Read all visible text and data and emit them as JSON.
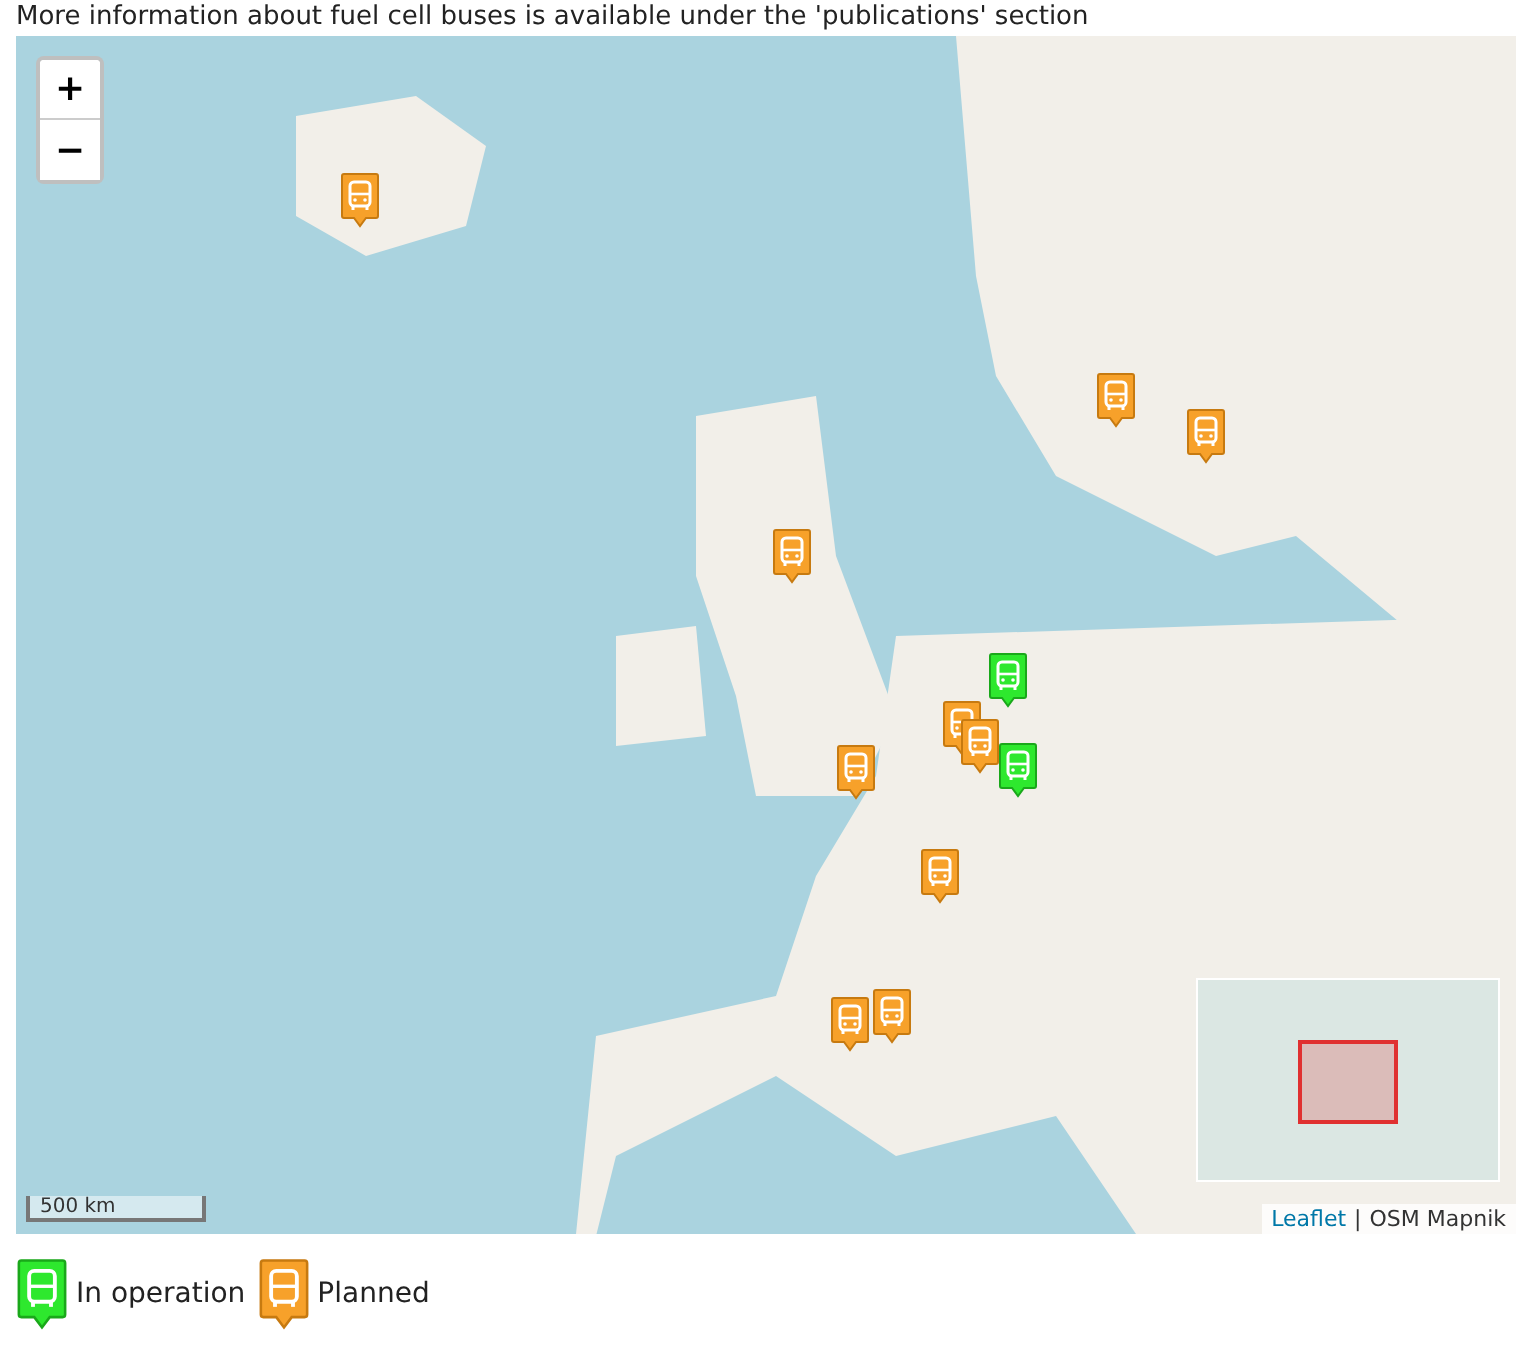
{
  "intro": "More information about fuel cell buses is available under the 'publications' section",
  "map": {
    "zoom_in": "+",
    "zoom_out": "−",
    "scale": "500 km",
    "attribution": {
      "link": "Leaflet",
      "separator": "|",
      "source": "OSM Mapnik"
    },
    "markers": [
      {
        "kind": "planned"
      },
      {
        "kind": "planned"
      },
      {
        "kind": "planned"
      },
      {
        "kind": "planned"
      },
      {
        "kind": "in_operation"
      },
      {
        "kind": "planned"
      },
      {
        "kind": "planned"
      },
      {
        "kind": "in_operation"
      },
      {
        "kind": "planned"
      },
      {
        "kind": "planned"
      },
      {
        "kind": "planned"
      },
      {
        "kind": "planned"
      }
    ]
  },
  "legend": [
    {
      "kind": "in_operation",
      "label": "In operation"
    },
    {
      "kind": "planned",
      "label": "Planned"
    }
  ]
}
